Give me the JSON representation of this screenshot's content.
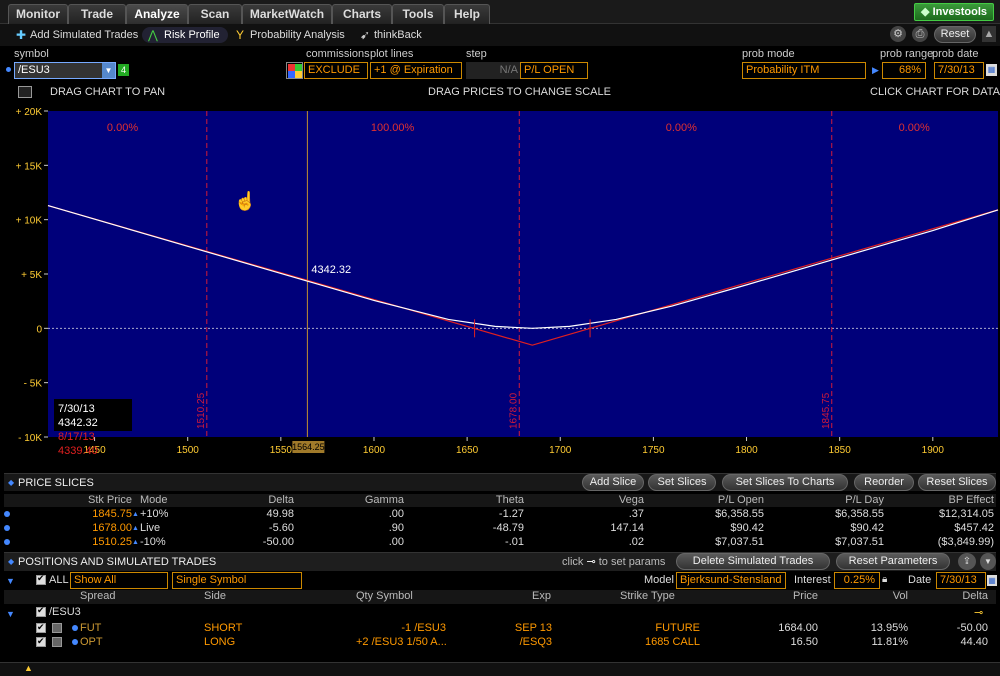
{
  "tabs": [
    "Monitor",
    "Trade",
    "Analyze",
    "Scan",
    "MarketWatch",
    "Charts",
    "Tools",
    "Help"
  ],
  "active_tab": "Analyze",
  "brand": "Investools",
  "subtabs": [
    {
      "icon": "plus-icon",
      "label": "Add Simulated Trades"
    },
    {
      "icon": "risk-profile-icon",
      "label": "Risk Profile"
    },
    {
      "icon": "probability-icon",
      "label": "Probability Analysis"
    },
    {
      "icon": "thinkback-icon",
      "label": "thinkBack"
    }
  ],
  "reset_label": "Reset",
  "controls": {
    "symbol_label": "symbol",
    "symbol": "/ESU3",
    "symbol_badge": "4",
    "commissions_label": "commissions",
    "commissions": "EXCLUDE",
    "plot_lines_label": "plot lines",
    "plot_lines": "+1 @ Expiration",
    "step_label": "step",
    "step": "N/A",
    "pl_mode": "P/L OPEN",
    "prob_mode_label": "prob mode",
    "prob_mode": "Probability ITM",
    "prob_range_label": "prob range",
    "prob_range": "68%",
    "prob_date_label": "prob date",
    "prob_date": "7/30/13"
  },
  "chart_hints": {
    "left": "DRAG CHART TO PAN",
    "center": "DRAG PRICES TO CHANGE SCALE",
    "right": "CLICK CHART FOR DATA"
  },
  "colors": {
    "plot_bg": "#00007a",
    "expiration_line": "#e02020",
    "current_line": "#ffffff",
    "slice_line": "#d01a3a",
    "price_line": "#c09030",
    "prob_text": "#e03030"
  },
  "chart_data": {
    "type": "line",
    "xlim": [
      1425,
      1935
    ],
    "ylim": [
      -10000,
      20000
    ],
    "x_ticks": [
      1450,
      1500,
      1550,
      1600,
      1650,
      1700,
      1750,
      1800,
      1850,
      1900
    ],
    "y_ticks": [
      {
        "v": 20000,
        "t": "+ 20K"
      },
      {
        "v": 15000,
        "t": "+ 15K"
      },
      {
        "v": 10000,
        "t": "+ 10K"
      },
      {
        "v": 5000,
        "t": "+ 5K"
      },
      {
        "v": 0,
        "t": "0"
      },
      {
        "v": -5000,
        "t": "- 5K"
      },
      {
        "v": -10000,
        "t": "- 10K"
      }
    ],
    "series": [
      {
        "name": "+1 @ Expiration",
        "x": [
          1425,
          1685,
          1935
        ],
        "y": [
          11300,
          -1550,
          10900
        ]
      },
      {
        "name": "",
        "x": [
          1425,
          1500,
          1550,
          1600,
          1640,
          1665,
          1685,
          1705,
          1730,
          1760,
          1800,
          1850,
          1900,
          1935
        ],
        "y": [
          11300,
          7550,
          5050,
          2570,
          820,
          180,
          0,
          180,
          820,
          2050,
          4000,
          6500,
          9000,
          10900
        ]
      }
    ],
    "slices": [
      1510.25,
      1678.0,
      1845.75
    ],
    "current_price": 1564.25,
    "current_price_label": "1564.25",
    "breakevens": [
      1654,
      1716
    ],
    "prob_labels": [
      {
        "x": 1465,
        "t": "0.00%"
      },
      {
        "x": 1610,
        "t": "100.00%"
      },
      {
        "x": 1765,
        "t": "0.00%"
      },
      {
        "x": 1890,
        "t": "0.00%"
      }
    ],
    "point_label": {
      "x": 1564.25,
      "y": 4342.32,
      "t": "4342.32"
    },
    "legend": [
      {
        "t": "7/30/13  4342.32",
        "color": "#ffffff"
      },
      {
        "t": "8/17/13  4339.40",
        "color": "#e02020"
      }
    ]
  },
  "price_slices": {
    "title": "PRICE SLICES",
    "buttons": [
      "Add Slice",
      "Set Slices",
      "Set Slices To Charts",
      "Reorder",
      "Reset Slices"
    ],
    "headers": [
      "Stk Price",
      "Mode",
      "Delta",
      "Gamma",
      "Theta",
      "Vega",
      "P/L Open",
      "P/L Day",
      "BP Effect"
    ],
    "rows": [
      [
        "1845.75",
        "+10%",
        "49.98",
        ".00",
        "-1.27",
        ".37",
        "$6,358.55",
        "$6,358.55",
        "$12,314.05"
      ],
      [
        "1678.00",
        "Live",
        "-5.60",
        ".90",
        "-48.79",
        "147.14",
        "$90.42",
        "$90.42",
        "$457.42"
      ],
      [
        "1510.25",
        "-10%",
        "-50.00",
        ".00",
        "-.01",
        ".02",
        "$7,037.51",
        "$7,037.51",
        "($3,849.99)"
      ]
    ]
  },
  "positions": {
    "title": "POSITIONS AND SIMULATED TRADES",
    "click_hint_pre": "click",
    "click_hint_post": "to set params",
    "buttons": [
      "Delete Simulated Trades",
      "Reset Parameters"
    ],
    "all_label": "ALL",
    "filter": "Show All",
    "symbol_filter": "Single Symbol",
    "model_label": "Model",
    "model": "Bjerksund-Stensland",
    "interest_label": "Interest",
    "interest": "0.25%",
    "date_label": "Date",
    "date": "7/30/13",
    "headers": [
      "Spread",
      "Side",
      "Qty Symbol",
      "Exp",
      "Strike Type",
      "Price",
      "Vol",
      "Delta"
    ],
    "group": "/ESU3",
    "rows": [
      [
        "FUT",
        "SHORT",
        "-1 /ESU3",
        "SEP 13",
        "FUTURE",
        "1684.00",
        "13.95%",
        "-50.00"
      ],
      [
        "OPT",
        "LONG",
        "+2 /ESU3 1/50 A...",
        "/ESQ3",
        "1685 CALL",
        "16.50",
        "11.81%",
        "44.40"
      ]
    ]
  }
}
